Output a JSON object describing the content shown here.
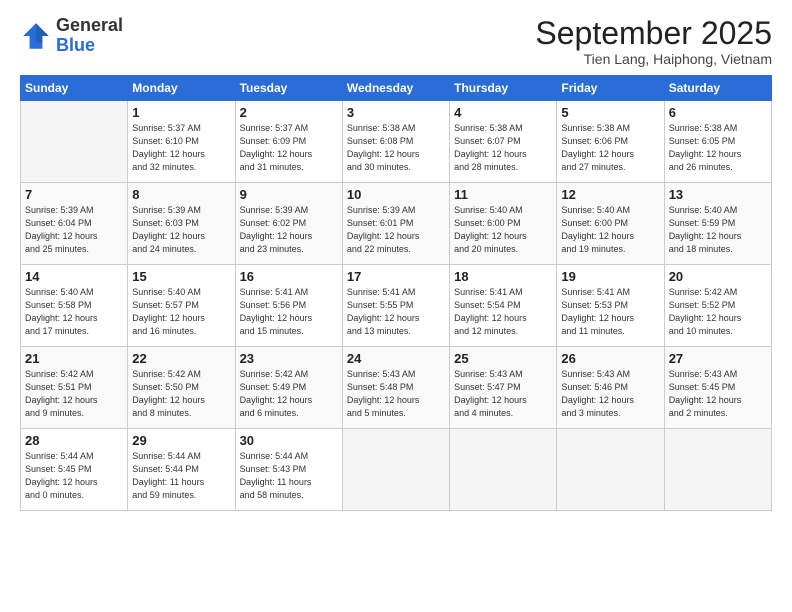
{
  "header": {
    "logo_general": "General",
    "logo_blue": "Blue",
    "month_title": "September 2025",
    "subtitle": "Tien Lang, Haiphong, Vietnam"
  },
  "days_of_week": [
    "Sunday",
    "Monday",
    "Tuesday",
    "Wednesday",
    "Thursday",
    "Friday",
    "Saturday"
  ],
  "weeks": [
    [
      {
        "day": "",
        "info": ""
      },
      {
        "day": "1",
        "info": "Sunrise: 5:37 AM\nSunset: 6:10 PM\nDaylight: 12 hours\nand 32 minutes."
      },
      {
        "day": "2",
        "info": "Sunrise: 5:37 AM\nSunset: 6:09 PM\nDaylight: 12 hours\nand 31 minutes."
      },
      {
        "day": "3",
        "info": "Sunrise: 5:38 AM\nSunset: 6:08 PM\nDaylight: 12 hours\nand 30 minutes."
      },
      {
        "day": "4",
        "info": "Sunrise: 5:38 AM\nSunset: 6:07 PM\nDaylight: 12 hours\nand 28 minutes."
      },
      {
        "day": "5",
        "info": "Sunrise: 5:38 AM\nSunset: 6:06 PM\nDaylight: 12 hours\nand 27 minutes."
      },
      {
        "day": "6",
        "info": "Sunrise: 5:38 AM\nSunset: 6:05 PM\nDaylight: 12 hours\nand 26 minutes."
      }
    ],
    [
      {
        "day": "7",
        "info": "Sunrise: 5:39 AM\nSunset: 6:04 PM\nDaylight: 12 hours\nand 25 minutes."
      },
      {
        "day": "8",
        "info": "Sunrise: 5:39 AM\nSunset: 6:03 PM\nDaylight: 12 hours\nand 24 minutes."
      },
      {
        "day": "9",
        "info": "Sunrise: 5:39 AM\nSunset: 6:02 PM\nDaylight: 12 hours\nand 23 minutes."
      },
      {
        "day": "10",
        "info": "Sunrise: 5:39 AM\nSunset: 6:01 PM\nDaylight: 12 hours\nand 22 minutes."
      },
      {
        "day": "11",
        "info": "Sunrise: 5:40 AM\nSunset: 6:00 PM\nDaylight: 12 hours\nand 20 minutes."
      },
      {
        "day": "12",
        "info": "Sunrise: 5:40 AM\nSunset: 6:00 PM\nDaylight: 12 hours\nand 19 minutes."
      },
      {
        "day": "13",
        "info": "Sunrise: 5:40 AM\nSunset: 5:59 PM\nDaylight: 12 hours\nand 18 minutes."
      }
    ],
    [
      {
        "day": "14",
        "info": "Sunrise: 5:40 AM\nSunset: 5:58 PM\nDaylight: 12 hours\nand 17 minutes."
      },
      {
        "day": "15",
        "info": "Sunrise: 5:40 AM\nSunset: 5:57 PM\nDaylight: 12 hours\nand 16 minutes."
      },
      {
        "day": "16",
        "info": "Sunrise: 5:41 AM\nSunset: 5:56 PM\nDaylight: 12 hours\nand 15 minutes."
      },
      {
        "day": "17",
        "info": "Sunrise: 5:41 AM\nSunset: 5:55 PM\nDaylight: 12 hours\nand 13 minutes."
      },
      {
        "day": "18",
        "info": "Sunrise: 5:41 AM\nSunset: 5:54 PM\nDaylight: 12 hours\nand 12 minutes."
      },
      {
        "day": "19",
        "info": "Sunrise: 5:41 AM\nSunset: 5:53 PM\nDaylight: 12 hours\nand 11 minutes."
      },
      {
        "day": "20",
        "info": "Sunrise: 5:42 AM\nSunset: 5:52 PM\nDaylight: 12 hours\nand 10 minutes."
      }
    ],
    [
      {
        "day": "21",
        "info": "Sunrise: 5:42 AM\nSunset: 5:51 PM\nDaylight: 12 hours\nand 9 minutes."
      },
      {
        "day": "22",
        "info": "Sunrise: 5:42 AM\nSunset: 5:50 PM\nDaylight: 12 hours\nand 8 minutes."
      },
      {
        "day": "23",
        "info": "Sunrise: 5:42 AM\nSunset: 5:49 PM\nDaylight: 12 hours\nand 6 minutes."
      },
      {
        "day": "24",
        "info": "Sunrise: 5:43 AM\nSunset: 5:48 PM\nDaylight: 12 hours\nand 5 minutes."
      },
      {
        "day": "25",
        "info": "Sunrise: 5:43 AM\nSunset: 5:47 PM\nDaylight: 12 hours\nand 4 minutes."
      },
      {
        "day": "26",
        "info": "Sunrise: 5:43 AM\nSunset: 5:46 PM\nDaylight: 12 hours\nand 3 minutes."
      },
      {
        "day": "27",
        "info": "Sunrise: 5:43 AM\nSunset: 5:45 PM\nDaylight: 12 hours\nand 2 minutes."
      }
    ],
    [
      {
        "day": "28",
        "info": "Sunrise: 5:44 AM\nSunset: 5:45 PM\nDaylight: 12 hours\nand 0 minutes."
      },
      {
        "day": "29",
        "info": "Sunrise: 5:44 AM\nSunset: 5:44 PM\nDaylight: 11 hours\nand 59 minutes."
      },
      {
        "day": "30",
        "info": "Sunrise: 5:44 AM\nSunset: 5:43 PM\nDaylight: 11 hours\nand 58 minutes."
      },
      {
        "day": "",
        "info": ""
      },
      {
        "day": "",
        "info": ""
      },
      {
        "day": "",
        "info": ""
      },
      {
        "day": "",
        "info": ""
      }
    ]
  ]
}
